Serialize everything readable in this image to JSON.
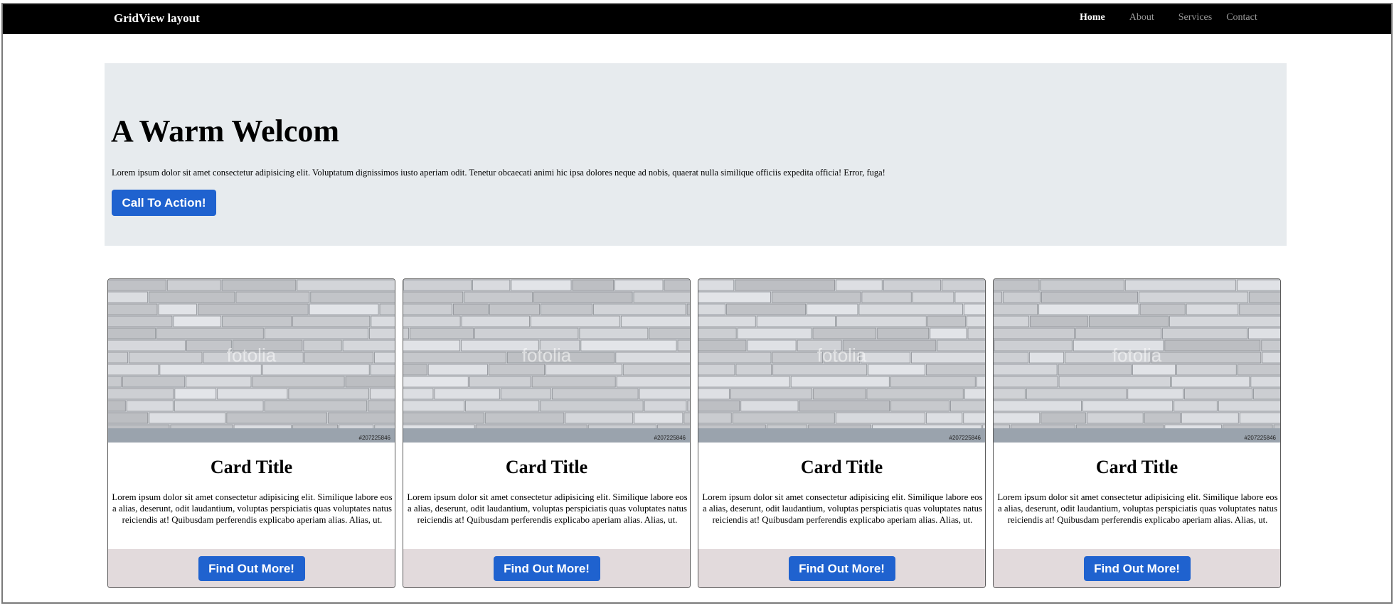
{
  "navbar": {
    "brand": "GridView layout",
    "links": [
      {
        "label": "Home",
        "active": true
      },
      {
        "label": "About",
        "active": false
      },
      {
        "label": "Services",
        "active": false
      },
      {
        "label": "Contact",
        "active": false
      }
    ]
  },
  "hero": {
    "title": "A Warm Welcom",
    "text": "Lorem ipsum dolor sit amet consectetur adipisicing elit. Voluptatum dignissimos iusto aperiam odit. Tenetur obcaecati animi hic ipsa dolores neque ad nobis, quaerat nulla similique officiis expedita officia! Error, fuga!",
    "button_label": "Call To Action!"
  },
  "cards": [
    {
      "title": "Card Title",
      "text": "Lorem ipsum dolor sit amet consectetur adipisicing elit. Similique labore eos a alias, deserunt, odit laudantium, voluptas perspiciatis quas voluptates natus reiciendis at! Quibusdam perferendis explicabo aperiam alias. Alias, ut.",
      "button_label": "Find Out More!",
      "image_watermark": "fotolia",
      "image_id": "#207225846"
    },
    {
      "title": "Card Title",
      "text": "Lorem ipsum dolor sit amet consectetur adipisicing elit. Similique labore eos a alias, deserunt, odit laudantium, voluptas perspiciatis quas voluptates natus reiciendis at! Quibusdam perferendis explicabo aperiam alias. Alias, ut.",
      "button_label": "Find Out More!",
      "image_watermark": "fotolia",
      "image_id": "#207225846"
    },
    {
      "title": "Card Title",
      "text": "Lorem ipsum dolor sit amet consectetur adipisicing elit. Similique labore eos a alias, deserunt, odit laudantium, voluptas perspiciatis quas voluptates natus reiciendis at! Quibusdam perferendis explicabo aperiam alias. Alias, ut.",
      "button_label": "Find Out More!",
      "image_watermark": "fotolia",
      "image_id": "#207225846"
    },
    {
      "title": "Card Title",
      "text": "Lorem ipsum dolor sit amet consectetur adipisicing elit. Similique labore eos a alias, deserunt, odit laudantium, voluptas perspiciatis quas voluptates natus reiciendis at! Quibusdam perferendis explicabo aperiam alias. Alias, ut.",
      "button_label": "Find Out More!",
      "image_watermark": "fotolia",
      "image_id": "#207225846"
    }
  ],
  "colors": {
    "navbar_bg": "#000000",
    "hero_bg": "#e7ebee",
    "button_bg": "#1f62cf",
    "card_footer_bg": "#e2dadc"
  }
}
